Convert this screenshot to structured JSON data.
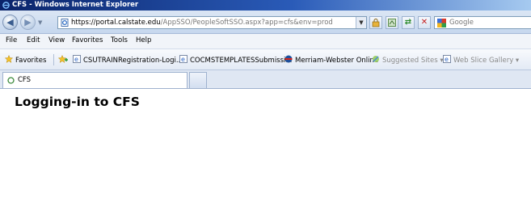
{
  "window": {
    "title": "CFS - Windows Internet Explorer"
  },
  "address_bar": {
    "url_host": "https://portal.calstate.edu",
    "url_path": "/AppSSO/PeopleSoftSSO.aspx?app=cfs&env=prod"
  },
  "search": {
    "placeholder": "Google"
  },
  "menu": [
    "File",
    "Edit",
    "View",
    "Favorites",
    "Tools",
    "Help"
  ],
  "favorites": {
    "label": "Favorites",
    "items": [
      "CSUTRAINRegistration-Logi...",
      "COCMSTEMPLATESSubmissi...",
      "Merriam-Webster Online",
      "Suggested Sites ▾",
      "Web Slice Gallery ▾"
    ]
  },
  "tab": {
    "label": "CFS"
  },
  "page": {
    "heading": "Logging-in to CFS"
  },
  "colors": {
    "titlebar": "#0a246a",
    "accent": "#2a5bb8"
  }
}
